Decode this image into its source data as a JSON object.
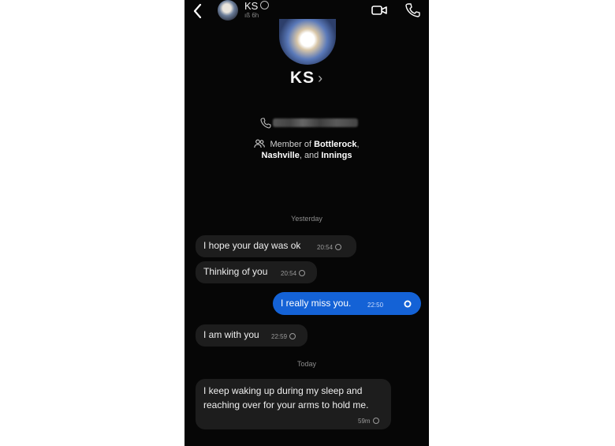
{
  "header": {
    "back_icon": "chevron-left-icon",
    "name": "KS",
    "status": "ıß 6h",
    "video_icon": "video-camera-icon",
    "call_icon": "phone-icon"
  },
  "profile": {
    "name": "KS",
    "chevron": "›",
    "phone_icon": "phone-icon",
    "member_prefix": "Member of",
    "groups": [
      "Bottlerock",
      "Nashville",
      "Innings"
    ],
    "member_sep_1": ",",
    "member_sep_2": ", and",
    "member_suffix": ""
  },
  "messages": [
    {
      "day": "Yesterday"
    },
    {
      "text": "I hope your day was ok",
      "time": "20:54",
      "direction": "received"
    },
    {
      "text": "Thinking of you",
      "time": "20:54",
      "direction": "received"
    },
    {
      "text": "I really miss you.",
      "time": "22:50",
      "direction": "sent"
    },
    {
      "text": "I am with you",
      "time": "22:59",
      "direction": "received"
    },
    {
      "day": "Today"
    },
    {
      "text": "I keep waking up during my sleep and reaching over for your arms to hold me.",
      "time": "59m",
      "direction": "received"
    }
  ]
}
